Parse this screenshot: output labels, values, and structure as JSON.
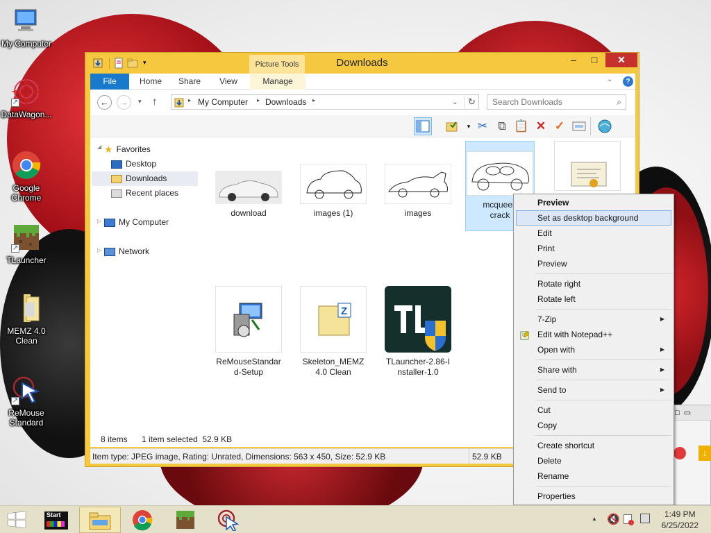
{
  "desktop": {
    "icons": [
      {
        "label": "My Computer"
      },
      {
        "label": "DataWagon..."
      },
      {
        "label": "Google Chrome"
      },
      {
        "label": "TLauncher"
      },
      {
        "label": "MEMZ 4.0 Clean"
      },
      {
        "label": "ReMouse Standard"
      }
    ]
  },
  "window": {
    "title": "Downloads",
    "contextual_tab_group": "Picture Tools",
    "tabs": [
      "File",
      "Home",
      "Share",
      "View",
      "Manage"
    ],
    "address": [
      "My Computer",
      "Downloads"
    ],
    "search_placeholder": "Search Downloads"
  },
  "navpane": {
    "favorites": "Favorites",
    "items": [
      "Desktop",
      "Downloads",
      "Recent places"
    ],
    "my_computer": "My Computer",
    "network": "Network"
  },
  "files": [
    {
      "name": "download"
    },
    {
      "name": "images (1)"
    },
    {
      "name": "images"
    },
    {
      "name": "mcqueen crack"
    },
    {
      "name": "ReMouseStandard-Setup"
    },
    {
      "name": "Skeleton_MEMZ 4.0 Clean"
    },
    {
      "name": "TLauncher-2.86-Installer-1.0"
    }
  ],
  "file_labels": {
    "download": "download",
    "images1": "images (1)",
    "images": "images",
    "mcqueen_l1": "mcqueen",
    "mcqueen_l2": "crack",
    "remouse_l1": "ReMouseStandar",
    "remouse_l2": "d-Setup",
    "skeleton_l1": "Skeleton_MEMZ",
    "skeleton_l2": "4.0 Clean",
    "tl_l1": "TLauncher-2.86-I",
    "tl_l2": "nstaller-1.0"
  },
  "status": {
    "item_count": "8 items",
    "selection": "1 item selected  52.9 KB",
    "details": "Item type: JPEG image, Rating: Unrated, Dimensions: 563 x 450, Size: 52.9 KB",
    "size": "52.9 KB"
  },
  "context_menu": {
    "items": [
      {
        "label": "Preview"
      },
      {
        "label": "Set as desktop background"
      },
      {
        "label": "Edit"
      },
      {
        "label": "Print"
      },
      {
        "label": "Preview"
      },
      {
        "label": "Rotate right"
      },
      {
        "label": "Rotate left"
      },
      {
        "label": "7-Zip"
      },
      {
        "label": "Edit with Notepad++"
      },
      {
        "label": "Open with"
      },
      {
        "label": "Share with"
      },
      {
        "label": "Send to"
      },
      {
        "label": "Cut"
      },
      {
        "label": "Copy"
      },
      {
        "label": "Create shortcut"
      },
      {
        "label": "Delete"
      },
      {
        "label": "Rename"
      },
      {
        "label": "Properties"
      }
    ]
  },
  "taskbar": {
    "start_label": "Start",
    "time": "1:49 PM",
    "date": "6/25/2022"
  },
  "colors": {
    "window_frame": "#f6c83f",
    "file_tab": "#1979ca",
    "close_button": "#c7312d",
    "selection": "#cde8ff",
    "taskbar": "#e4e0c9"
  }
}
